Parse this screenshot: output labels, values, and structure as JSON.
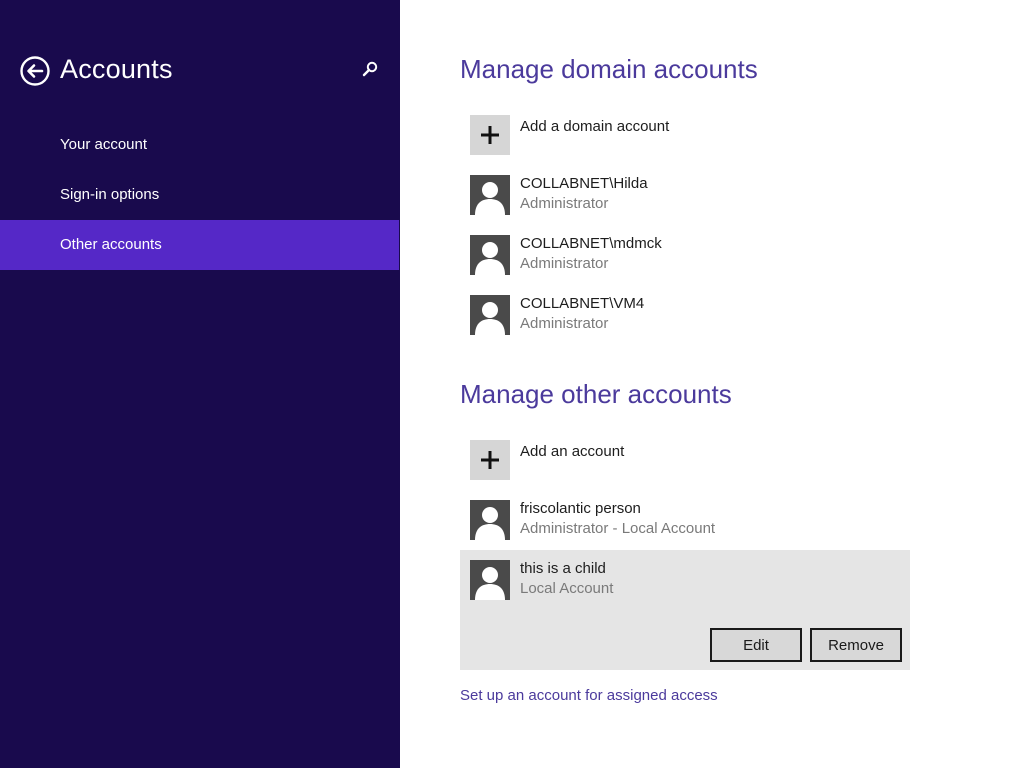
{
  "sidebar": {
    "title": "Accounts",
    "back_icon": "back-arrow-circle-icon",
    "search_icon": "search-icon",
    "items": [
      {
        "label": "Your account",
        "selected": false
      },
      {
        "label": "Sign-in options",
        "selected": false
      },
      {
        "label": "Other accounts",
        "selected": true
      }
    ]
  },
  "domain_section": {
    "title": "Manage domain accounts",
    "add_label": "Add a domain account",
    "accounts": [
      {
        "name": "COLLABNET\\Hilda",
        "role": "Administrator"
      },
      {
        "name": "COLLABNET\\mdmck",
        "role": "Administrator"
      },
      {
        "name": "COLLABNET\\VM4",
        "role": "Administrator"
      }
    ]
  },
  "other_section": {
    "title": "Manage other accounts",
    "add_label": "Add an account",
    "accounts": [
      {
        "name": "friscolantic person",
        "role": "Administrator - Local Account",
        "selected": false
      },
      {
        "name": "this is a child",
        "role": "Local Account",
        "selected": true
      }
    ],
    "edit_label": "Edit",
    "remove_label": "Remove"
  },
  "assigned_access_link": "Set up an account for assigned access",
  "colors": {
    "sidebar_bg": "#190a4d",
    "selected_nav": "#5528c7",
    "heading": "#4b3a9c",
    "selected_row": "#e5e5e5"
  }
}
